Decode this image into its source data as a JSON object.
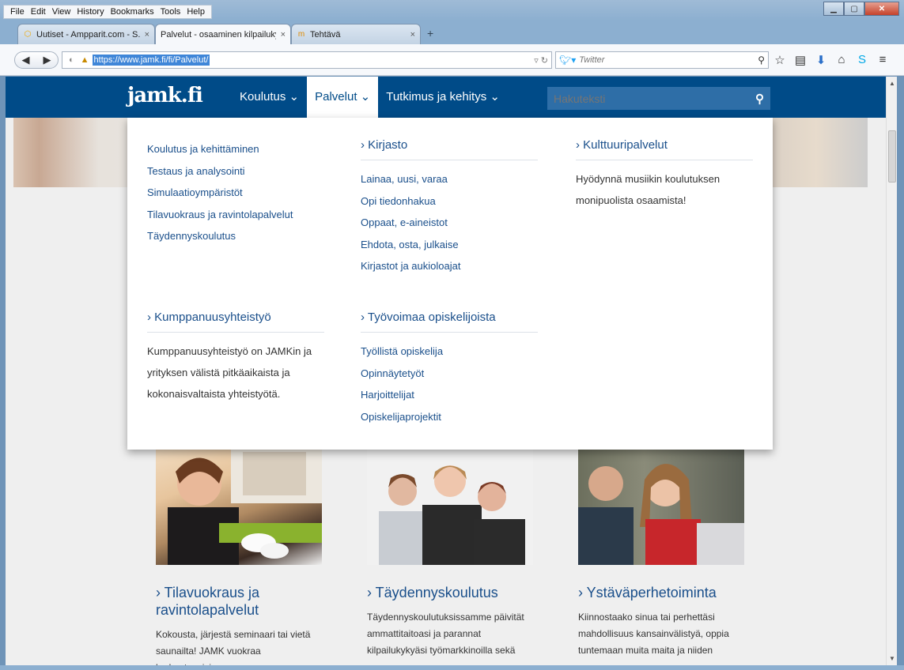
{
  "menubar": [
    "File",
    "Edit",
    "View",
    "History",
    "Bookmarks",
    "Tools",
    "Help"
  ],
  "tabs": [
    {
      "label": "Uutiset - Ampparit.com - S...",
      "close": "×"
    },
    {
      "label": "Palvelut - osaaminen kilpailuky...",
      "close": "×"
    },
    {
      "label": "Tehtävä",
      "close": "×"
    }
  ],
  "newtab": "+",
  "url": "https://www.jamk.fi/fi/Palvelut/",
  "searchbar": {
    "placeholder": "Twitter"
  },
  "site": {
    "logo": "jamk.fi",
    "nav": [
      "Koulutus ⌄",
      "Palvelut ⌄",
      "Tutkimus ja kehitys ⌄"
    ],
    "search_placeholder": "Hakuteksti"
  },
  "mega": {
    "col1_links": [
      "Koulutus ja kehittäminen",
      "Testaus ja analysointi",
      "Simulaatioympäristöt",
      "Tilavuokraus ja ravintolapalvelut",
      "Täydennyskoulutus"
    ],
    "kirjasto": {
      "title": "Kirjasto",
      "links": [
        "Lainaa, uusi, varaa",
        "Opi tiedonhakua",
        "Oppaat, e-aineistot",
        "Ehdota, osta, julkaise",
        "Kirjastot ja aukioloajat"
      ]
    },
    "kulttuuri": {
      "title": "Kulttuuripalvelut",
      "text": "Hyödynnä musiikin koulutuksen monipuolista osaamista!"
    },
    "kumppanuus": {
      "title": "Kumppanuusyhteistyö",
      "text": "Kumppanuusyhteistyö on JAMKin ja yrityksen välistä pitkäaikaista ja kokonaisvaltaista yhteistyötä."
    },
    "tyovoima": {
      "title": "Työvoimaa opiskelijoista",
      "links": [
        "Työllistä opiskelija",
        "Opinnäytetyöt",
        "Harjoittelijat",
        "Opiskelijaprojektit"
      ]
    }
  },
  "cards": [
    {
      "title": "Tilavuokraus ja ravintolapalvelut",
      "text": "Kokousta, järjestä seminaari tai vietä saunailta! JAMK vuokraa korkeatasoisia"
    },
    {
      "title": "Täydennyskoulutus",
      "text": "Täydennyskoulutuksissamme päivität ammattitaitoasi ja parannat kilpailukykyäsi työmarkkinoilla sekä"
    },
    {
      "title": "Ystäväperhetoiminta",
      "text": "Kiinnostaako sinua tai perhettäsi mahdollisuus kansainvälistyä, oppia tuntemaan muita maita ja niiden"
    }
  ],
  "colors": {
    "brand": "#004b88",
    "link": "#1a4f8b",
    "search": "#2e6ea7"
  }
}
